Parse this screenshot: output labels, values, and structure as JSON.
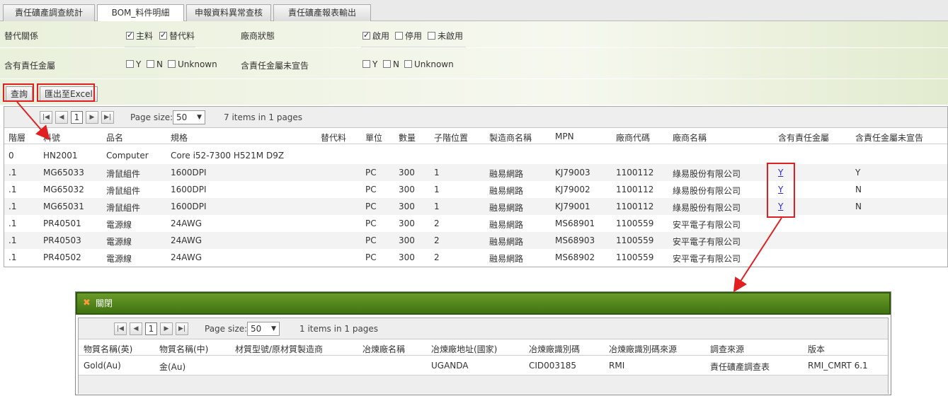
{
  "tabs": [
    "責任礦產調查統計",
    "BOM_料件明細",
    "申報資料異常查核",
    "責任礦產報表輸出"
  ],
  "filters": {
    "row1": {
      "label1": "替代關係",
      "opts1": [
        "主料",
        "替代料"
      ],
      "label2": "廠商狀態",
      "opts2": [
        "啟用",
        "停用",
        "未啟用"
      ]
    },
    "row2": {
      "label1": "含有責任金屬",
      "opts1": [
        "Y",
        "N",
        "Unknown"
      ],
      "label2": "含責任金屬未宣告",
      "opts2": [
        "Y",
        "N",
        "Unknown"
      ]
    }
  },
  "buttons": {
    "query": "查詢",
    "export": "匯出至Excel"
  },
  "pager": {
    "page": "1",
    "page_size_label": "Page size:",
    "page_size": "50",
    "summary": "7 items in 1 pages"
  },
  "columns": [
    "階層",
    "料號",
    "品名",
    "規格",
    "替代料",
    "單位",
    "數量",
    "子階位置",
    "製造商名稱",
    "MPN",
    "廠商代碼",
    "廠商名稱",
    "含有責任金屬",
    "含責任金屬未宣告"
  ],
  "rows": [
    [
      "0",
      "HN2001",
      "Computer",
      "Core i52-7300 H521M D9Z",
      "",
      "",
      "",
      "",
      "",
      "",
      "",
      "",
      "",
      ""
    ],
    [
      ".1",
      "MG65033",
      "滑鼠組件",
      "1600DPI",
      "",
      "PC",
      "300",
      "1",
      "融易網路",
      "KJ79003",
      "1100112",
      "綠易股份有限公司",
      "Y",
      "Y"
    ],
    [
      ".1",
      "MG65032",
      "滑鼠組件",
      "1600DPI",
      "",
      "PC",
      "300",
      "1",
      "融易網路",
      "KJ79002",
      "1100112",
      "綠易股份有限公司",
      "Y",
      "N"
    ],
    [
      ".1",
      "MG65031",
      "滑鼠組件",
      "1600DPI",
      "",
      "PC",
      "300",
      "1",
      "融易網路",
      "KJ79001",
      "1100112",
      "綠易股份有限公司",
      "Y",
      "N"
    ],
    [
      ".1",
      "PR40501",
      "電源線",
      "24AWG",
      "",
      "PC",
      "300",
      "2",
      "融易網路",
      "MS68901",
      "1100559",
      "安平電子有限公司",
      "",
      ""
    ],
    [
      ".1",
      "PR40503",
      "電源線",
      "24AWG",
      "",
      "PC",
      "300",
      "2",
      "融易網路",
      "MS68903",
      "1100559",
      "安平電子有限公司",
      "",
      ""
    ],
    [
      ".1",
      "PR40502",
      "電源線",
      "24AWG",
      "",
      "PC",
      "300",
      "2",
      "融易網路",
      "MS68902",
      "1100559",
      "安平電子有限公司",
      "",
      ""
    ]
  ],
  "popup": {
    "close_label": "關閉",
    "pager": {
      "page": "1",
      "page_size_label": "Page size:",
      "page_size": "50",
      "summary": "1 items in 1 pages"
    },
    "columns": [
      "物質名稱(英)",
      "物質名稱(中)",
      "材質型號/原材質製造商",
      "冶煉廠名稱",
      "冶煉廠地址(國家)",
      "冶煉廠識別碼",
      "冶煉廠識別碼來源",
      "調查來源",
      "版本"
    ],
    "rows": [
      [
        "Gold(Au)",
        "金(Au)",
        "",
        "",
        "UGANDA",
        "CID003185",
        "RMI",
        "責任礦產調查表",
        "RMI_CMRT 6.1"
      ]
    ]
  },
  "colors": {
    "highlight": "#e02020",
    "popup_bar": "#4f8a1a"
  }
}
